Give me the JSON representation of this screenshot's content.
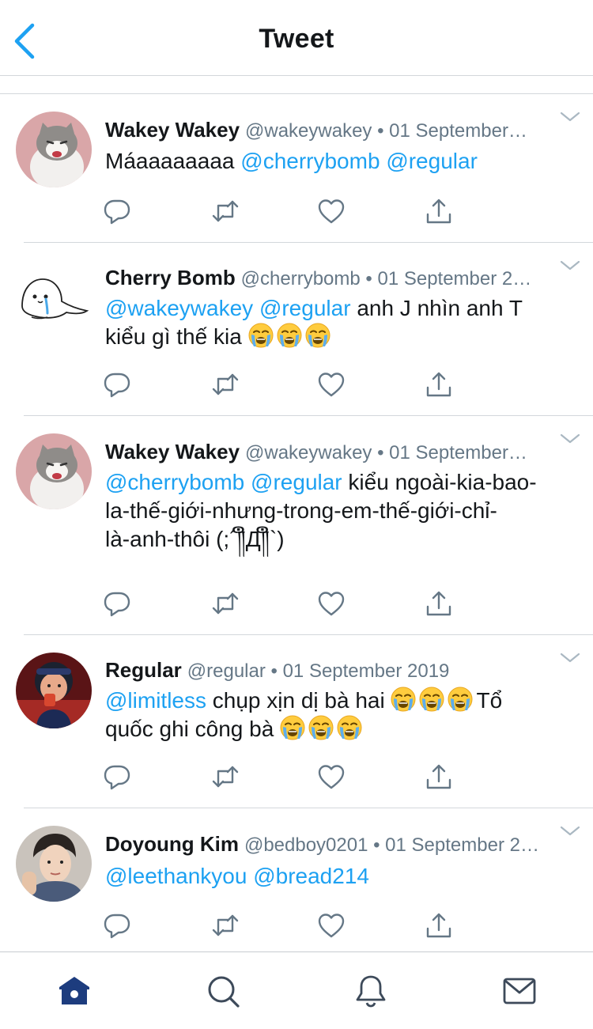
{
  "header": {
    "title": "Tweet"
  },
  "tweets": [
    {
      "name": "Wakey Wakey",
      "meta": "@wakeywakey • 01 September…",
      "m1": "Máaaaaaaaa",
      "m2": "@cherrybomb",
      "m3": "@regular"
    },
    {
      "name": "Cherry Bomb",
      "meta": "@cherrybomb • 01 September 2…",
      "m1": "@wakeywakey",
      "m2": "@regular",
      "t1": "anh J nhìn anh T",
      "t2": "kiểu gì thế kia"
    },
    {
      "name": "Wakey Wakey",
      "meta": "@wakeywakey • 01 September…",
      "m1": "@cherrybomb",
      "m2": "@regular",
      "t1": "kiểu ngoài-kia-bao-",
      "t2": "la-thế-giới-nhưng-trong-em-thế-giới-chỉ-",
      "t3": "là-anh-thôi (;´༎ຶД༎ຶ`)"
    },
    {
      "name": "Regular",
      "meta": "@regular • 01 September 2019",
      "m1": "@limitless",
      "t1": "chụp xịn dị bà hai",
      "t2": "Tổ",
      "t3": "quốc ghi công bà"
    },
    {
      "name": "Doyoung Kim",
      "meta": "@bedboy0201 • 01 September 2…",
      "m1": "@leethankyou",
      "m2": "@bread214"
    }
  ],
  "icons": {
    "reply": "reply-icon",
    "retweet": "retweet-icon",
    "like": "heart-icon",
    "share": "share-icon",
    "emoji": "loudly-crying-face-emoji"
  },
  "colors": {
    "accent": "#1da1f2",
    "icon_gray": "#657786",
    "tab_active": "#1d3c7e"
  }
}
